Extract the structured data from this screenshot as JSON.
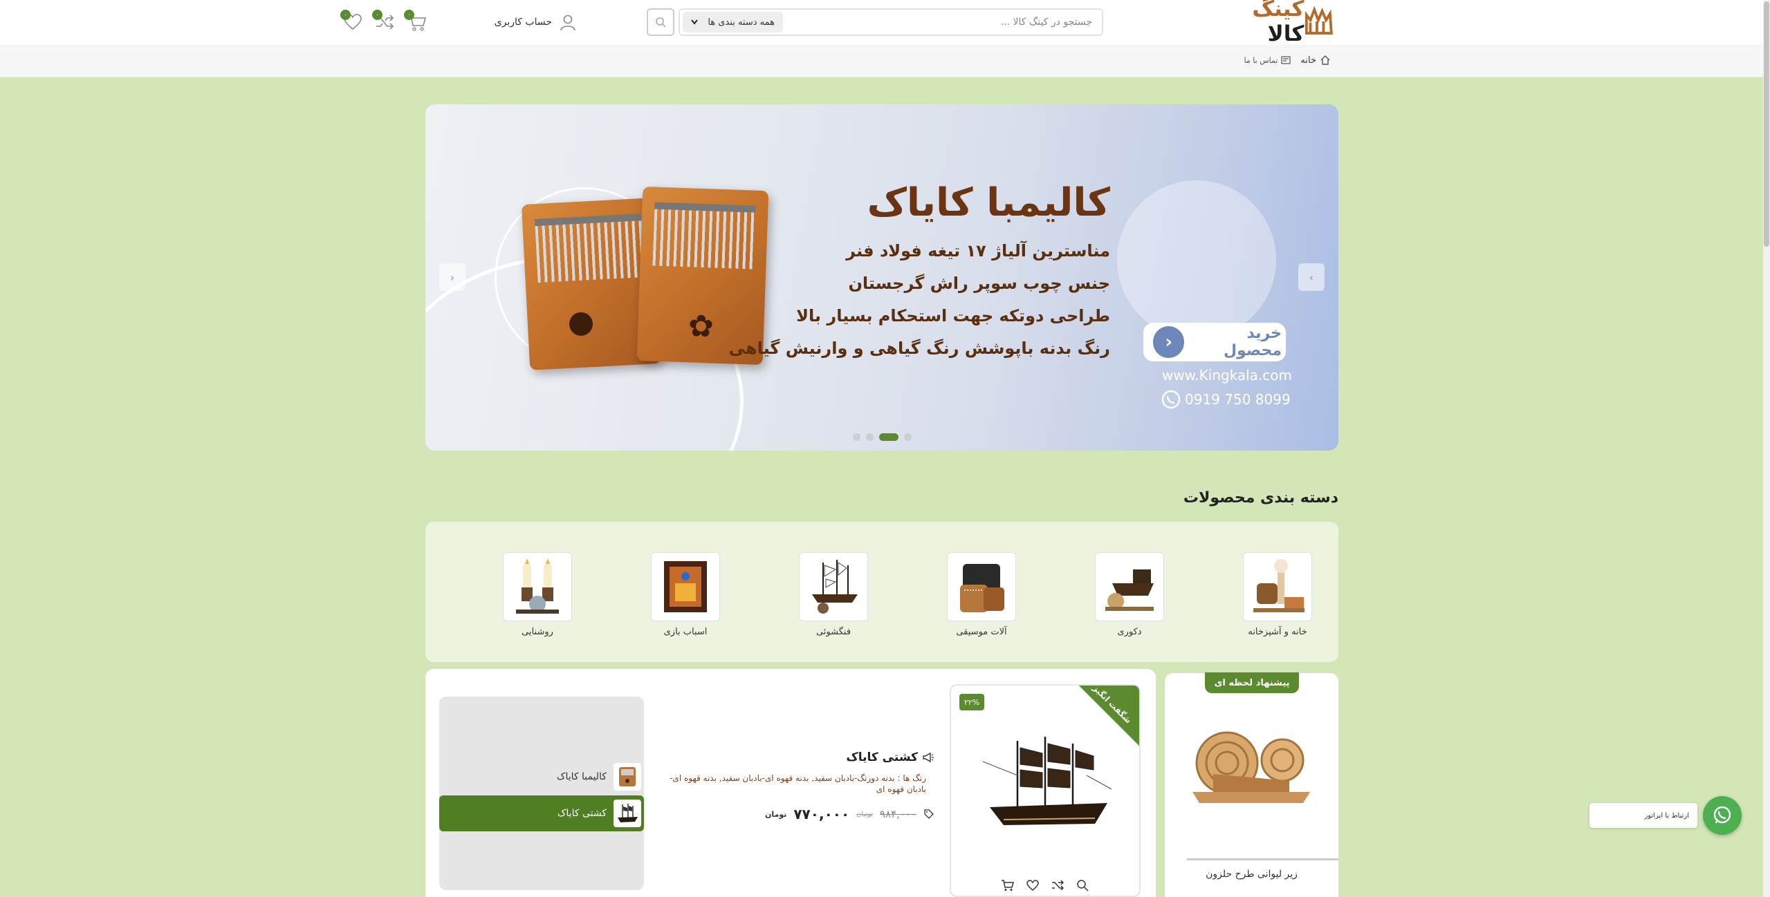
{
  "header": {
    "logo_main": "کینگ",
    "logo_accent": "کالا",
    "search_placeholder": "جستجو در کینگ کالا ...",
    "category_select": "همه دسته بندی ها",
    "account_label": "حساب کاربری",
    "cart_count": "۰",
    "compare_count": "۰",
    "wishlist_count": "۰"
  },
  "subnav": {
    "home": "خانه",
    "contact": "تماس با ما"
  },
  "slider": {
    "title": "کالیمبا کایاک",
    "lines": [
      "مناسترین آلیاژ ۱۷ تیغه فولاد فنر",
      "جنس چوب سوپر راش گرجستان",
      "طراحی دوتکه جهت استحکام بسیار بالا",
      "رنگ بدنه باپوشش رنگ گیاهی و وارنیش گیاهی"
    ],
    "buy_label": "خرید محصول",
    "website": "www.Kingkala.com",
    "phone": "0919 750 8099",
    "active_slide": 3,
    "slide_count": 4
  },
  "categories": {
    "heading": "دسته بندی محصولات",
    "items": [
      {
        "label": "خانه و آشپزخانه"
      },
      {
        "label": "دکوری"
      },
      {
        "label": "آلات موسیقی"
      },
      {
        "label": "فنگشوئی"
      },
      {
        "label": "اسباب بازی"
      },
      {
        "label": "روشنایی"
      }
    ]
  },
  "deal": {
    "tag": "پیشنهاد لحظه ای",
    "title": "زیر لیوانی طرح حلزون"
  },
  "product": {
    "ribbon": "شگفت انگیز",
    "discount": "۲۲%",
    "title": "کشتی کایاک",
    "desc": "رنگ ها : بدنه دورنگ-بادبان سفید, بدنه قهوه ای-بادبان سفید, بدنه قهوه ای-بادبان قهوه ای",
    "old_price": "۹۸۴,۰۰۰",
    "old_unit": "تومان",
    "new_price": "۷۷۰,۰۰۰",
    "new_unit": "تومان"
  },
  "tabs": [
    {
      "label": "کالیمبا کایاک",
      "active": false
    },
    {
      "label": "کشتی کایاک",
      "active": true
    }
  ],
  "whatsapp": {
    "tooltip": "ارتباط با اپراتور"
  },
  "colors": {
    "page_bg": "#d3e6b7",
    "brand_green": "#5c8a2e",
    "logo_accent": "#b36a2a"
  }
}
